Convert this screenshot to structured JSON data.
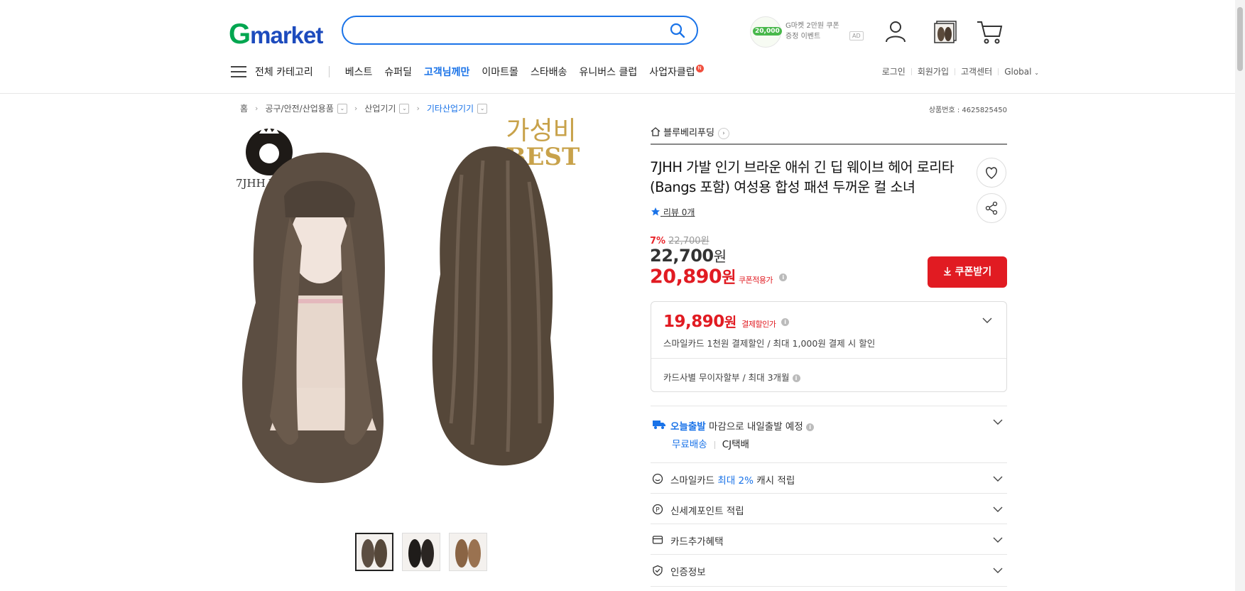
{
  "header": {
    "logo_g": "G",
    "logo_rest": "market",
    "search": {
      "placeholder": "",
      "value": ""
    },
    "promo": {
      "badge": "20,000",
      "line1": "G마켓 2만원 쿠폰",
      "line2": "증정 이벤트",
      "ad": "AD"
    },
    "icons": [
      "user-icon",
      "recent-item-icon",
      "cart-icon"
    ]
  },
  "nav": {
    "all_categories": "전체 카테고리",
    "items": [
      {
        "label": "베스트"
      },
      {
        "label": "슈퍼딜"
      },
      {
        "label": "고객님께만"
      },
      {
        "label": "이마트몰"
      },
      {
        "label": "스타배송"
      },
      {
        "label": "유니버스 클럽"
      },
      {
        "label": "사업자클럽",
        "badge": "N"
      }
    ],
    "util": [
      "로그인",
      "회원가입",
      "고객센터",
      "Global"
    ]
  },
  "breadcrumb": [
    "홈",
    "공구/안전/산업용품",
    "산업기기",
    "기타산업기기"
  ],
  "product_no": "상품번호 : 4625825450",
  "image": {
    "brand_text": "7JHH WIGS",
    "promo_line1": "가성비",
    "promo_line2": "BEST",
    "thumb_count": 3
  },
  "store": {
    "name": "블루베리푸딩"
  },
  "product": {
    "title": "7JHH 가발 인기 브라운 애쉬 긴 딥 웨이브 헤어 로리타 (Bangs 포함) 여성용 합성 패션 두꺼운 컬 소녀",
    "review": "리뷰 0개",
    "discount_pct": "7%",
    "original_price": "22,700원",
    "price": "22,700",
    "coupon_price": "20,890",
    "coupon_label": "쿠폰적용가",
    "won": "원",
    "coupon_button": "쿠폰받기"
  },
  "payment": {
    "price": "19,890",
    "label": "결제할인가",
    "line1": "스마일카드 1천원 결제할인 / 최대 1,000원 결제 시 할인",
    "line2": "카드사별 무이자할부 / 최대 3개월"
  },
  "shipping": {
    "today": "오늘출발",
    "deadline": "마감으로 내일출발 예정",
    "free": "무료배송",
    "carrier": "CJ택배"
  },
  "benefits": {
    "smilecard_pre": "스마일카드",
    "smilecard_highlight": "최대 2%",
    "smilecard_post": "캐시 적립",
    "shinsegae": "신세계포인트 적립",
    "card_extra": "카드추가혜택",
    "cert": "인증정보"
  },
  "colors": {
    "accent": "#1a73e8",
    "price_red": "#e11b22",
    "logo_green": "#00a650",
    "logo_blue": "#1d4bbd"
  }
}
